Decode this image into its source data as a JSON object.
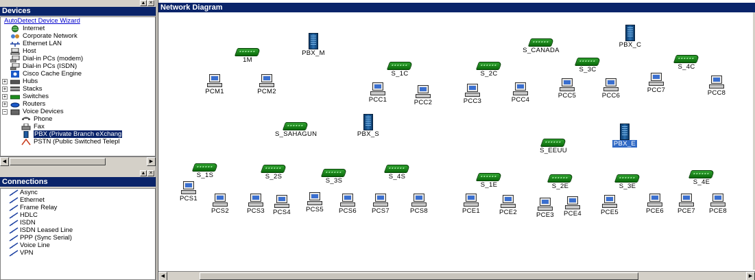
{
  "devices_panel": {
    "title": "Devices",
    "wizard_link": "AutoDetect Device Wizard",
    "items": [
      {
        "label": "Internet",
        "icon": "globe-icon",
        "level": 0,
        "expander": ""
      },
      {
        "label": "Corporate Network",
        "icon": "network-icon",
        "level": 0,
        "expander": ""
      },
      {
        "label": "Ethernet LAN",
        "icon": "ethernet-icon",
        "level": 0,
        "expander": ""
      },
      {
        "label": "Host",
        "icon": "host-icon",
        "level": 0,
        "expander": ""
      },
      {
        "label": "Dial-in PCs (modem)",
        "icon": "modem-pc-icon",
        "level": 0,
        "expander": ""
      },
      {
        "label": "Dial-in PCs (ISDN)",
        "icon": "isdn-pc-icon",
        "level": 0,
        "expander": ""
      },
      {
        "label": "Cisco Cache Engine",
        "icon": "cache-engine-icon",
        "level": 0,
        "expander": ""
      },
      {
        "label": "Hubs",
        "icon": "hub-icon",
        "level": 0,
        "expander": "+"
      },
      {
        "label": "Stacks",
        "icon": "stack-icon",
        "level": 0,
        "expander": "+"
      },
      {
        "label": "Switches",
        "icon": "switch-icon",
        "level": 0,
        "expander": "+"
      },
      {
        "label": "Routers",
        "icon": "router-icon",
        "level": 0,
        "expander": "+"
      },
      {
        "label": "Voice Devices",
        "icon": "voice-device-icon",
        "level": 0,
        "expander": "−"
      },
      {
        "label": "Phone",
        "icon": "phone-icon",
        "level": 1,
        "expander": ""
      },
      {
        "label": "Fax",
        "icon": "fax-icon",
        "level": 1,
        "expander": ""
      },
      {
        "label": "PBX (Private Branch eXchang",
        "icon": "pbx-icon",
        "level": 1,
        "expander": "",
        "selected": true
      },
      {
        "label": "PSTN (Public Switched Telepl",
        "icon": "pstn-icon",
        "level": 1,
        "expander": ""
      }
    ]
  },
  "connections_panel": {
    "title": "Connections",
    "items": [
      "Async",
      "Ethernet",
      "Frame Relay",
      "HDLC",
      "ISDN",
      "ISDN Leased Line",
      "PPP (Sync Serial)",
      "Voice Line",
      "VPN"
    ]
  },
  "diagram": {
    "title": "Network Diagram",
    "nodes": [
      {
        "label": "1M",
        "type": "switch"
      },
      {
        "label": "PBX_M",
        "type": "pbx"
      },
      {
        "label": "PCM1",
        "type": "pc"
      },
      {
        "label": "PCM2",
        "type": "pc"
      },
      {
        "label": "S_1C",
        "type": "switch"
      },
      {
        "label": "S_2C",
        "type": "switch"
      },
      {
        "label": "S_CANADA",
        "type": "switch"
      },
      {
        "label": "PBX_C",
        "type": "pbx"
      },
      {
        "label": "S_3C",
        "type": "switch"
      },
      {
        "label": "S_4C",
        "type": "switch"
      },
      {
        "label": "PCC1",
        "type": "pc"
      },
      {
        "label": "PCC2",
        "type": "pc"
      },
      {
        "label": "PCC3",
        "type": "pc"
      },
      {
        "label": "PCC4",
        "type": "pc"
      },
      {
        "label": "PCC5",
        "type": "pc"
      },
      {
        "label": "PCC6",
        "type": "pc"
      },
      {
        "label": "PCC7",
        "type": "pc"
      },
      {
        "label": "PCC8",
        "type": "pc"
      },
      {
        "label": "S_SAHAGUN",
        "type": "switch"
      },
      {
        "label": "PBX_S",
        "type": "pbx"
      },
      {
        "label": "S_EEUU",
        "type": "switch"
      },
      {
        "label": "PBX_E",
        "type": "pbx",
        "highlight": true
      },
      {
        "label": "S_1S",
        "type": "switch"
      },
      {
        "label": "S_2S",
        "type": "switch"
      },
      {
        "label": "S_3S",
        "type": "switch"
      },
      {
        "label": "S_4S",
        "type": "switch"
      },
      {
        "label": "S_1E",
        "type": "switch"
      },
      {
        "label": "S_2E",
        "type": "switch"
      },
      {
        "label": "S_3E",
        "type": "switch"
      },
      {
        "label": "S_4E",
        "type": "switch"
      },
      {
        "label": "PCS1",
        "type": "pc"
      },
      {
        "label": "PCS2",
        "type": "pc"
      },
      {
        "label": "PCS3",
        "type": "pc"
      },
      {
        "label": "PCS4",
        "type": "pc"
      },
      {
        "label": "PCS5",
        "type": "pc"
      },
      {
        "label": "PCS6",
        "type": "pc"
      },
      {
        "label": "PCS7",
        "type": "pc"
      },
      {
        "label": "PCS8",
        "type": "pc"
      },
      {
        "label": "PCE1",
        "type": "pc"
      },
      {
        "label": "PCE2",
        "type": "pc"
      },
      {
        "label": "PCE3",
        "type": "pc"
      },
      {
        "label": "PCE4",
        "type": "pc"
      },
      {
        "label": "PCE5",
        "type": "pc"
      },
      {
        "label": "PCE6",
        "type": "pc"
      },
      {
        "label": "PCE7",
        "type": "pc"
      },
      {
        "label": "PCE8",
        "type": "pc"
      }
    ]
  }
}
